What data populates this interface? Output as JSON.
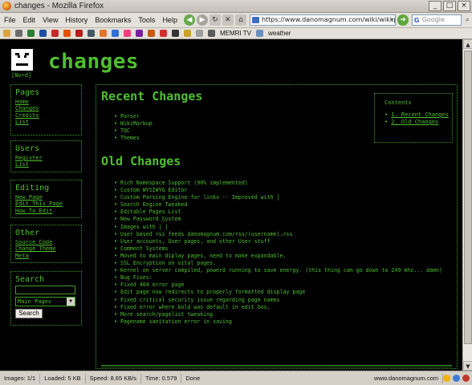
{
  "window": {
    "title": "changes - Mozilla Firefox",
    "controls": [
      "_",
      "□",
      "×"
    ]
  },
  "menu": [
    "File",
    "Edit",
    "View",
    "History",
    "Bookmarks",
    "Tools",
    "Help"
  ],
  "nav": {
    "url": "https://www.danomagnum.com/wiki/wiki.pl?page=chan",
    "search_placeholder": "Google"
  },
  "bookmarks": {
    "labels": [
      "MEMRI TV",
      "weather"
    ]
  },
  "site": {
    "title": "changes",
    "logo_caption": "[Nord]"
  },
  "sidebar": {
    "pages": {
      "heading": "Pages",
      "links": [
        "Home",
        "Changes",
        "Credits",
        "List"
      ]
    },
    "users": {
      "heading": "Users",
      "links": [
        "Register",
        "List"
      ]
    },
    "editing": {
      "heading": "Editing",
      "links": [
        "New Page",
        "Edit This Page",
        "How To Edit"
      ]
    },
    "other": {
      "heading": "Other",
      "links": [
        "Source Code",
        "Change Theme",
        "Meta"
      ]
    },
    "search": {
      "heading": "Search",
      "select_value": "Main Pages",
      "button": "Search"
    }
  },
  "main": {
    "recent_heading": "Recent Changes",
    "recent_items": [
      "Parser",
      "WikiMarkup",
      "TOC",
      "Themes"
    ],
    "old_heading": "Old Changes",
    "old_items": [
      "Rich Namespace Support (90% implemented)",
      "Custom WYSIWYG Editor",
      "Custom Parsing Engine for links -- Improved with |",
      "Search Engine Tweaked",
      "Editable Pages List",
      "New Password System",
      "Images with | |",
      "User based rss feeds danomagnum.com/rss/(username).rss",
      "User accounts, User pages, and other User stuff",
      "Comment Systems",
      "Moved to main diplay pages, need to make expandable.",
      "SSL Encryption on vital pages.",
      "Kernel on server compiled, powerd running to save energy.  (this thing can go down to 249 mhz... damn)",
      "Bug Fixes:",
      "Fixed 404 error page",
      "Edit page now redirects to properly formatted display page",
      "Fixed critical security issue regarding page names",
      "Fixed error where bold was default in edit box.",
      "More search/pagelist tweaking",
      "Pagename sanitation error in saving"
    ],
    "contents": {
      "title": "Contents",
      "items": [
        "1. Recent Changes",
        "2. Old Changes"
      ]
    }
  },
  "status": {
    "images": "Images: 1/1",
    "loaded": "Loaded: 5 KB",
    "speed": "Speed: 8.65 KB/s",
    "time": "Time: 0.579",
    "state": "Done",
    "domain": "www.danomagnum.com"
  },
  "colors": {
    "page_bg": "#000000",
    "text_green": "#4fbf2f",
    "border_green": "#3f9e2a"
  }
}
